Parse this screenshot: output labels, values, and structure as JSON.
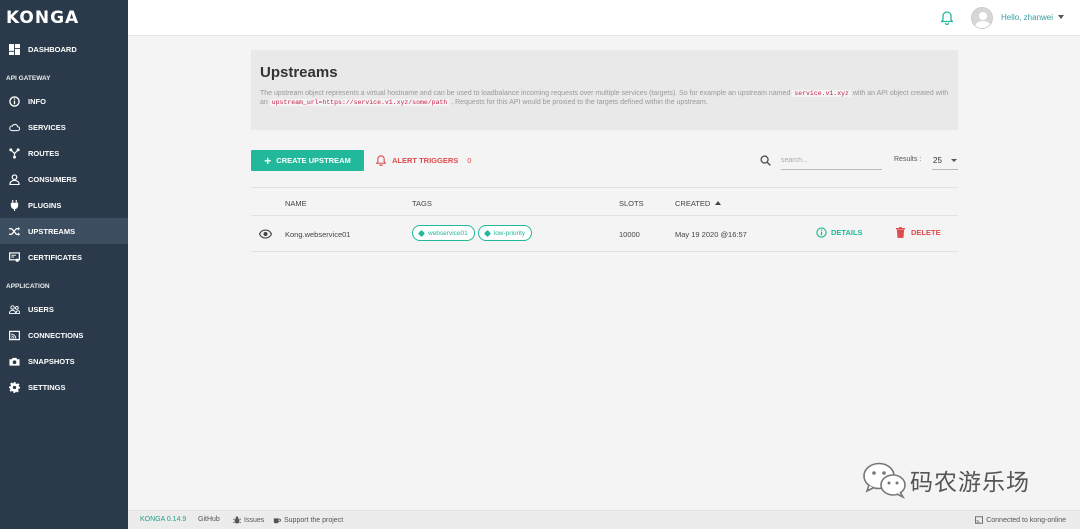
{
  "app": {
    "logo": "KONGA"
  },
  "sidebar": {
    "items": [
      {
        "label": "DASHBOARD",
        "icon": "dashboard-icon"
      },
      {
        "label": "INFO",
        "icon": "info-icon"
      },
      {
        "label": "SERVICES",
        "icon": "cloud-icon"
      },
      {
        "label": "ROUTES",
        "icon": "routes-icon"
      },
      {
        "label": "CONSUMERS",
        "icon": "user-icon"
      },
      {
        "label": "PLUGINS",
        "icon": "plug-icon"
      },
      {
        "label": "UPSTREAMS",
        "icon": "shuffle-icon"
      },
      {
        "label": "CERTIFICATES",
        "icon": "certificate-icon"
      },
      {
        "label": "USERS",
        "icon": "users-icon"
      },
      {
        "label": "CONNECTIONS",
        "icon": "connections-icon"
      },
      {
        "label": "SNAPSHOTS",
        "icon": "camera-icon"
      },
      {
        "label": "SETTINGS",
        "icon": "gear-icon"
      }
    ],
    "sections": {
      "api_gateway": "API GATEWAY",
      "application": "APPLICATION"
    },
    "active_item": "UPSTREAMS"
  },
  "topbar": {
    "greeting": "Hello, zhanwei"
  },
  "header": {
    "title": "Upstreams",
    "desc_1": "The upstream object represents a virtual hostname and can be used to loadbalance incoming requests over multiple services (targets). So for example an upstream named",
    "code_1": "service.v1.xyz",
    "desc_2": "with an API object created with an",
    "code_2": "upstream_url=https://service.v1.xyz/some/path",
    "desc_3": ". Requests for this API would be proxied to the targets defined within the upstream."
  },
  "toolbar": {
    "create_label": "CREATE UPSTREAM",
    "alert_label": "ALERT TRIGGERS",
    "alert_count": "0",
    "search_placeholder": "search...",
    "results_label": "Results :",
    "results_value": "25"
  },
  "table": {
    "columns": {
      "name": "NAME",
      "tags": "TAGS",
      "slots": "SLOTS",
      "created": "CREATED"
    },
    "rows": [
      {
        "name": "Kong.webservice01",
        "tags": [
          "webservice01",
          "low-priority"
        ],
        "slots": "10000",
        "created": "May 19 2020 @16:57",
        "details_label": "DETAILS",
        "delete_label": "DELETE"
      }
    ]
  },
  "footer": {
    "version": "KONGA 0.14.9",
    "github": "GitHub",
    "issues": "Issues",
    "support": "Support the project",
    "connection": "Connected to kong-online"
  },
  "watermark": {
    "text": "码农游乐场"
  },
  "colors": {
    "sidebar_bg": "#2b3a4a",
    "accent": "#22b89b",
    "danger": "#e04b4b"
  }
}
